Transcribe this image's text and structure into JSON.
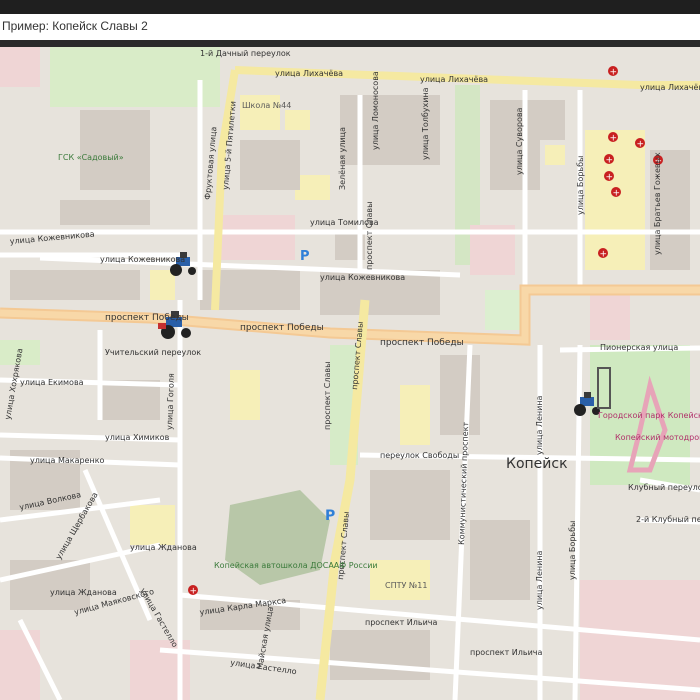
{
  "window": {
    "title": "Пример: Копейск Славы 2"
  },
  "map": {
    "city_label": "Копейск",
    "streets": {
      "likhacheva_1": "улица Лихачёва",
      "likhacheva_2": "улица Лихачёва",
      "likhacheva_3": "улица Лихачёва",
      "pyatiletka": "улица 5-й Пятилетки",
      "tomilova": "улица Томилова",
      "kozhevnikova_1": "улица Кожевникова",
      "kozhevnikova_2": "улица Кожевникова",
      "kozhevnikova_3": "улица Кожевникова",
      "pobedy_1": "проспект Победы",
      "pobedy_2": "проспект Победы",
      "pobedy_3": "проспект Победы",
      "slavy_1": "проспект Славы",
      "slavy_2": "проспект Славы",
      "slavy_3": "проспект Славы",
      "slavy_4": "проспект Славы",
      "uchitelsky": "Учительский переулок",
      "ekimova": "улица Екимова",
      "khimikov": "улица Химиков",
      "makarenko": "улица Макаренко",
      "svobody": "переулок Свободы",
      "kommunistichesky": "Коммунистический проспект",
      "lenina_1": "улица Ленина",
      "lenina_2": "улица Ленина",
      "borby_1": "улица Борьбы",
      "borby_2": "улица Борьбы",
      "pionerskaya": "Пионерская улица",
      "klubny": "Клубный переулок",
      "klubny_2": "2-й Клубный переулок",
      "marksa": "улица Карла Маркса",
      "ilyicha_1": "проспект Ильича",
      "ilyicha_2": "проспект Ильича",
      "gastello_1": "улица Гастелло",
      "gastello_2": "улица Гастелло",
      "zhdanova_1": "улица Жданова",
      "zhdanova_2": "улица Жданова",
      "volkova": "улица Волкова",
      "gogolya": "улица Гоголя",
      "frukt": "Фруктовая улица",
      "dachny": "1-й Дачный переулок",
      "suvorova": "улица Суворова",
      "bratev": "улица Братьев Гожевых",
      "lomanaya": "Зелёная улица",
      "kamennaya": "улица Ломоносова",
      "khorovoda": "улица Хохрякова",
      "mayakovskogo": "улица Маяковского",
      "shcherbakova": "улица Щербакова",
      "gagarina": "Майская улица",
      "tolbukhina": "улица Толбухина"
    },
    "places": {
      "school": "Школа №44",
      "gsk": "ГСК «Садовый»",
      "park": "Городской парк Копейска",
      "motodrom": "Копейский мотодром",
      "avtoshkola": "Копейская автошкола ДОСААФ России",
      "sptu": "СПТУ №11"
    },
    "markers": {
      "tractor_icons": 4,
      "hospital_icons": 9,
      "parking_icons": 2
    }
  }
}
